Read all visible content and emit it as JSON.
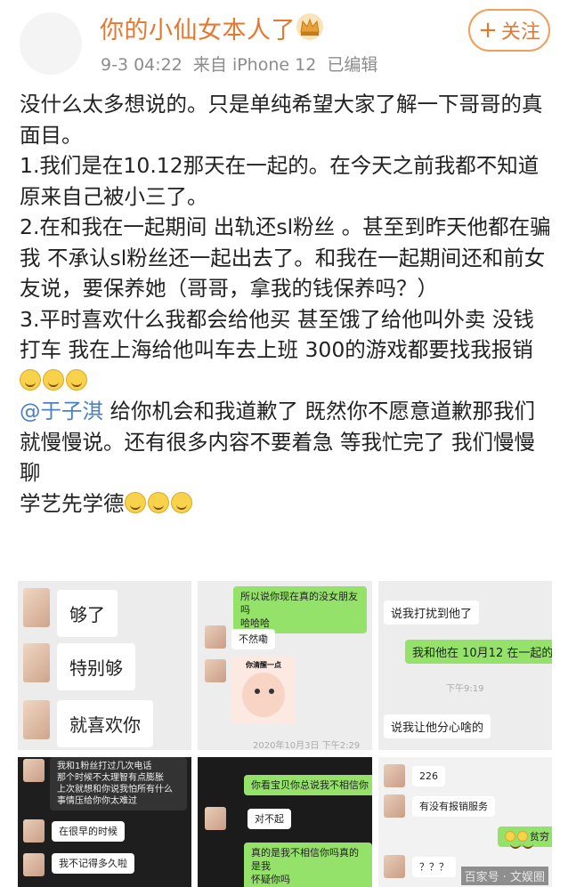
{
  "header": {
    "username": "你的小仙女本人了",
    "meta": "9-3 04:22  来自 iPhone 12  已编辑",
    "follow_label": "关注",
    "follow_plus": "+"
  },
  "post": {
    "lines": [
      "没什么太多想说的。只是单纯希望大家了解一下哥哥的真面目。",
      "1.我们是在10.12那天在一起的。在今天之前我都不知道原来自己被小三了。",
      "2.在和我在一起期间 出轨还sl粉丝 。甚至到昨天他都在骗我 不承认sl粉丝还一起出去了。和我在一起期间还和前女友说，要保养她（哥哥，拿我的钱保养吗？）",
      "3.平时喜欢什么我都会给他买 甚至饿了给他叫外卖 没钱打车 我在上海给他叫车去上班 300的游戏都要找我报销"
    ],
    "mention": "@于子淇",
    "mention_text": " 给你机会和我道歉了 既然你不愿意道歉那我们就慢慢说。还有很多内容不要着急 等我忙完了 我们慢慢聊",
    "closing": "学艺先学德"
  },
  "screenshots": {
    "s1": {
      "b1": "够了",
      "b2": "特别够",
      "b3": "就喜欢你"
    },
    "s2": {
      "b1": "所以说你现在真的没女朋友吗\n哈哈哈",
      "b2": "不然嘞",
      "sticker": "你清醒一点",
      "time": "2020年10月3日 下午2:29"
    },
    "s3": {
      "b1": "说我打扰到他了",
      "b2": "我和他在 10月12 在一起的",
      "time": "下午9:19",
      "b3": "说我让他分心啥的"
    },
    "s4": {
      "b1": "我和1粉丝打过几次电话\n那个时候不太理智有点膨胀\n上次就想和你说我怕所有什么\n事情压给你你太难过",
      "b2": "在很早的时候",
      "b3": "我不记得多久啦"
    },
    "s5": {
      "b1": "你看宝贝你总说我不相信你",
      "b2": "对不起",
      "b3": "真的是我不相信你吗真的是我\n怀疑你吗"
    },
    "s6": {
      "b1": "226",
      "b2": "有没有报销服务",
      "b3": "贫穷",
      "b4": "？？？"
    }
  },
  "watermark": "百家号 · 文娱圈",
  "colors": {
    "accent": "#e8772e",
    "link": "#4a80c8",
    "wechat_green": "#95e26a"
  },
  "icons": {
    "crown": "crown-icon",
    "emoji": "smile-emoji-icon"
  }
}
